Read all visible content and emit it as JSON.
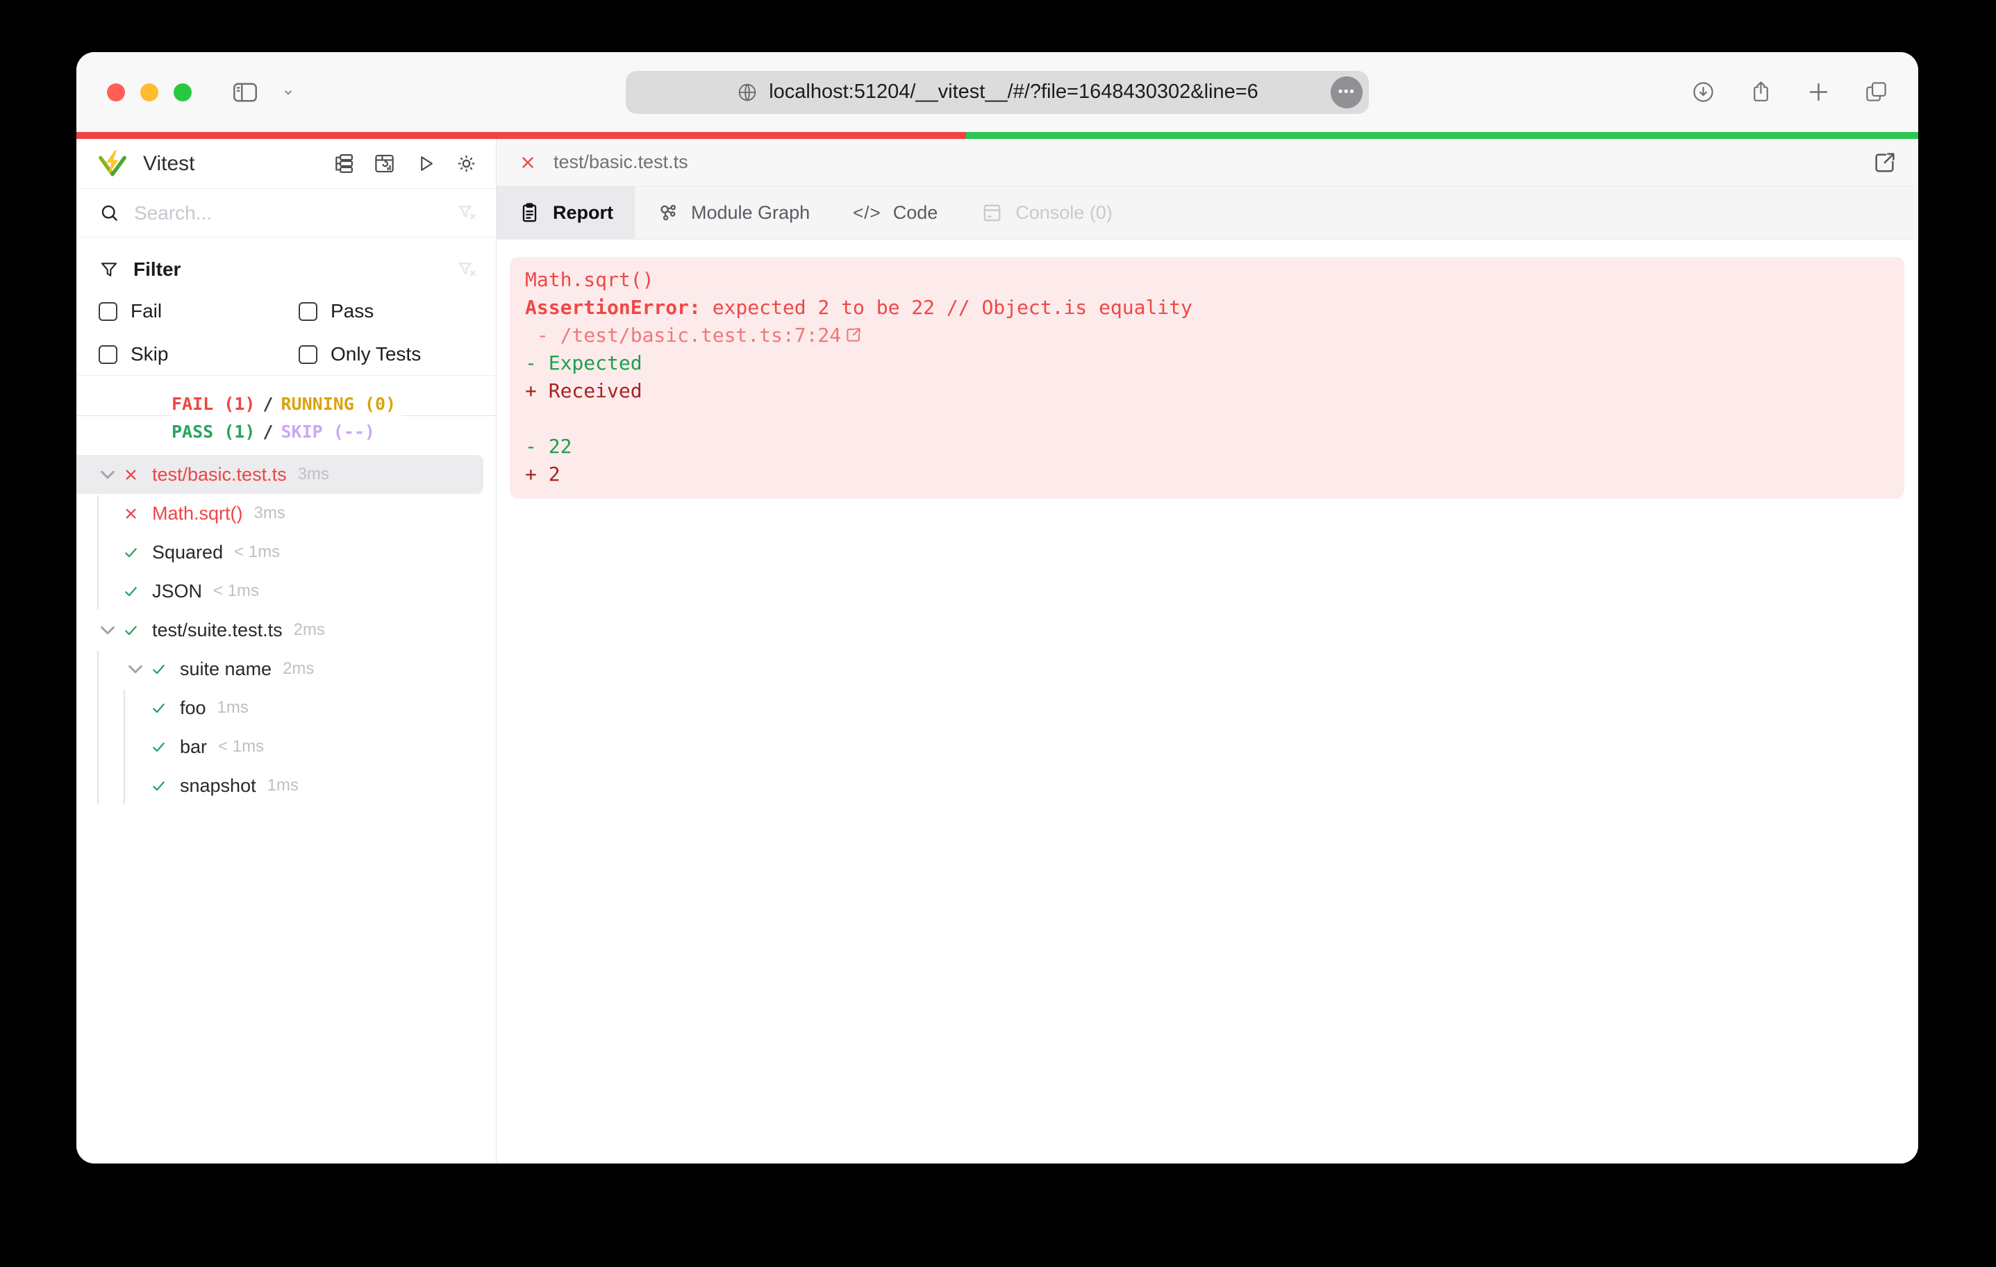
{
  "colors": {
    "fail": "#ef4444",
    "pass": "#27a45c",
    "running": "#d9a40a",
    "skip": "#cba7f5",
    "progress_fail": "#ef4444",
    "progress_pass": "#2dc653",
    "error_text": "#f04747",
    "stack_text": "#f07878",
    "diff_expected": "#1d9e4d",
    "diff_received": "#a82222",
    "error_bg": "#fcebea"
  },
  "progress": {
    "fail_ratio": 0.483
  },
  "browser": {
    "url": "localhost:51204/__vitest__/#/?file=1648430302&line=6",
    "more_label": "•••"
  },
  "sidebar": {
    "title": "Vitest",
    "search_placeholder": "Search...",
    "filter": {
      "title": "Filter",
      "options": [
        {
          "label": "Fail",
          "checked": false
        },
        {
          "label": "Pass",
          "checked": false
        },
        {
          "label": "Skip",
          "checked": false
        },
        {
          "label": "Only Tests",
          "checked": false
        }
      ]
    },
    "summary": {
      "fail": "FAIL (1)",
      "running": "RUNNING (0)",
      "pass": "PASS (1)",
      "skip": "SKIP (--)",
      "separator": "/"
    },
    "tree": [
      {
        "label": "test/basic.test.ts",
        "time": "3ms",
        "status": "fail",
        "depth": 0,
        "chevron": true,
        "selected": true
      },
      {
        "label": "Math.sqrt()",
        "time": "3ms",
        "status": "fail",
        "depth": 1
      },
      {
        "label": "Squared",
        "time": "< 1ms",
        "status": "pass",
        "depth": 1
      },
      {
        "label": "JSON",
        "time": "< 1ms",
        "status": "pass",
        "depth": 1
      },
      {
        "label": "test/suite.test.ts",
        "time": "2ms",
        "status": "pass",
        "depth": 0,
        "chevron": true
      },
      {
        "label": "suite name",
        "time": "2ms",
        "status": "pass",
        "depth": 1,
        "chevron": true
      },
      {
        "label": "foo",
        "time": "1ms",
        "status": "pass",
        "depth": 2
      },
      {
        "label": "bar",
        "time": "< 1ms",
        "status": "pass",
        "depth": 2
      },
      {
        "label": "snapshot",
        "time": "1ms",
        "status": "pass",
        "depth": 2
      }
    ]
  },
  "main": {
    "file_tab": {
      "label": "test/basic.test.ts"
    },
    "tabs": [
      {
        "label": "Report",
        "icon": "clipboard",
        "active": true
      },
      {
        "label": "Module Graph",
        "icon": "graph"
      },
      {
        "label": "Code",
        "icon": "code"
      },
      {
        "label": "Console (0)",
        "icon": "console",
        "disabled": true
      }
    ],
    "report": {
      "lines": [
        {
          "type": "error",
          "text": "Math.sqrt()"
        },
        {
          "type": "error",
          "bold": "AssertionError: ",
          "text": "expected 2 to be 22 // Object.is equality"
        },
        {
          "type": "stack",
          "text": " - /test/basic.test.ts:7:24",
          "external": true
        },
        {
          "type": "expected",
          "text": "- Expected"
        },
        {
          "type": "received",
          "text": "+ Received"
        },
        {
          "type": "blank",
          "text": ""
        },
        {
          "type": "expected",
          "text": "- 22"
        },
        {
          "type": "received",
          "text": "+ 2"
        }
      ]
    }
  }
}
